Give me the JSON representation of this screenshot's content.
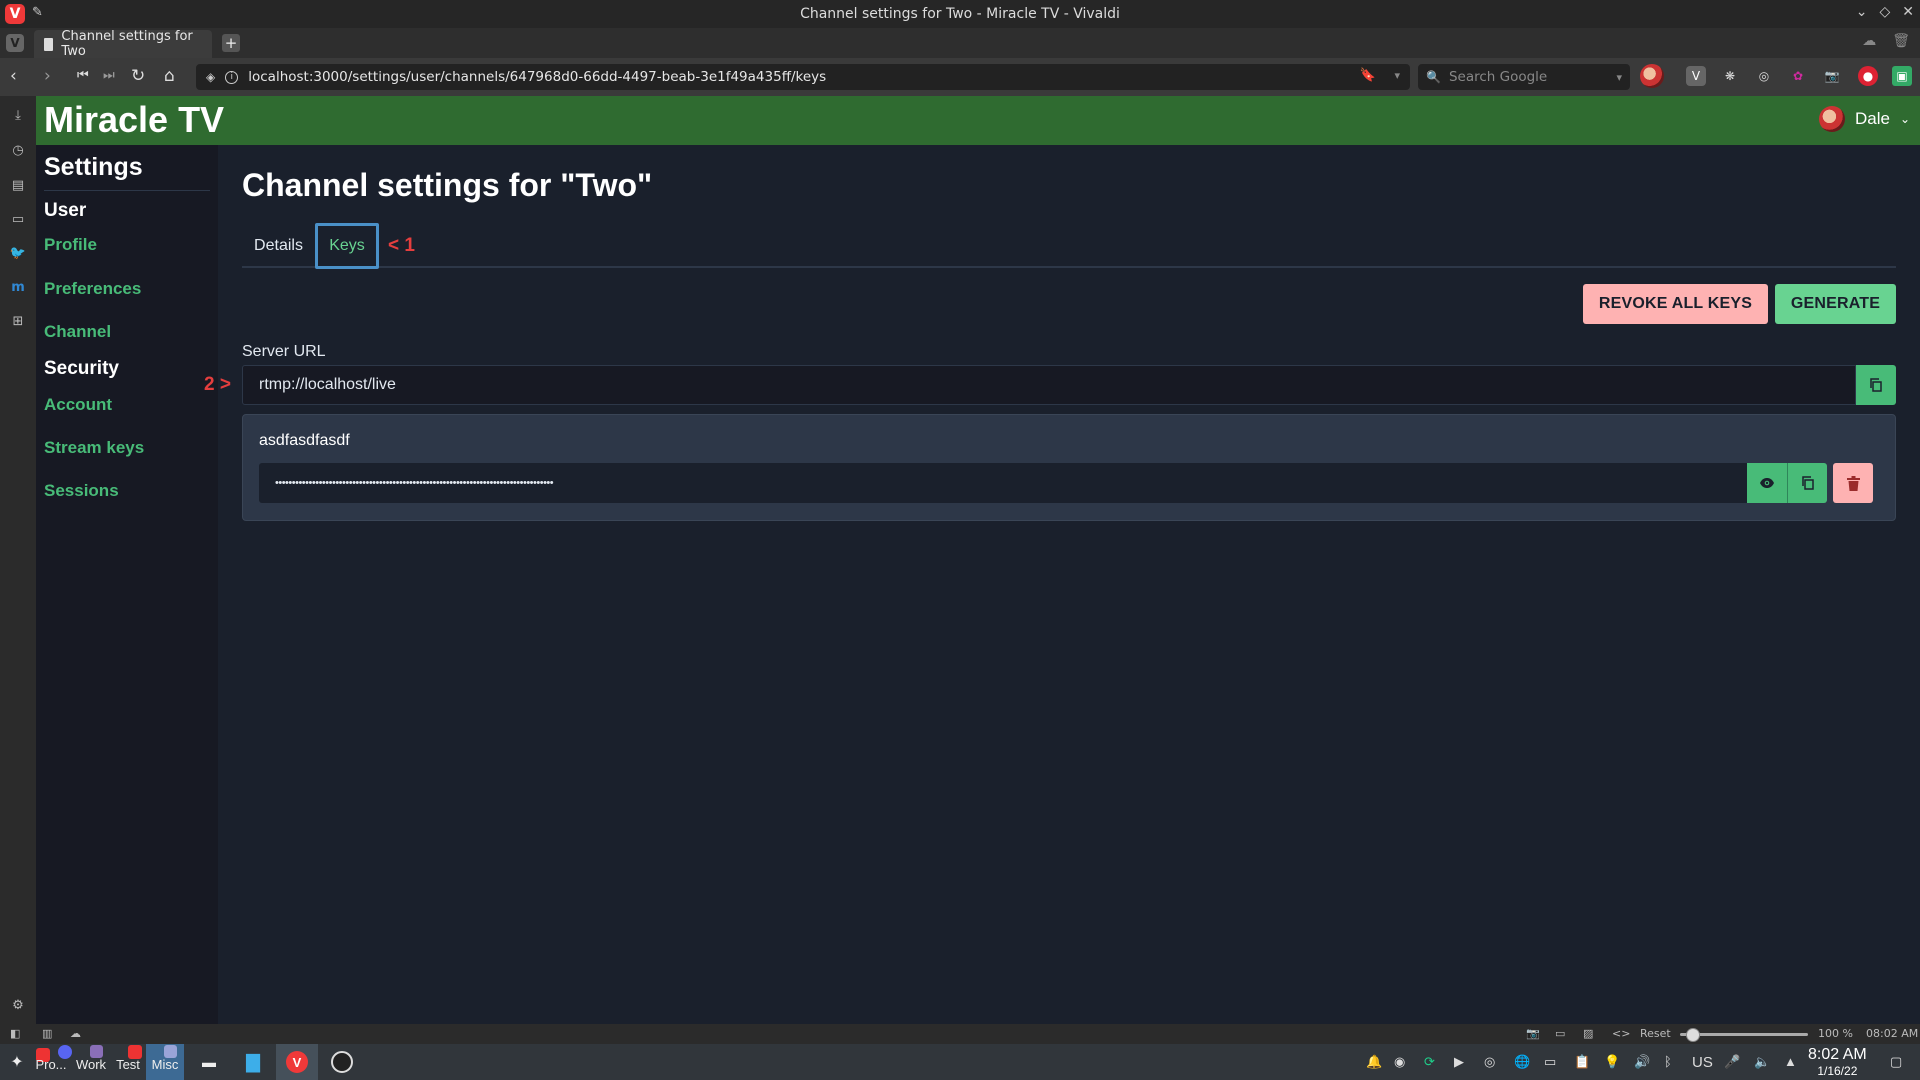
{
  "browser": {
    "window_title": "Channel settings for Two - Miracle TV - Vivaldi",
    "tab_title": "Channel settings for Two",
    "url": "localhost:3000/settings/user/channels/647968d0-66dd-4497-beab-3e1f49a435ff/keys",
    "search_placeholder": "Search Google",
    "status": {
      "reset": "Reset",
      "zoom": "100 %",
      "time": "08:02 AM",
      "zoom_level": 0.1
    }
  },
  "header": {
    "brand": "Miracle TV",
    "username": "Dale"
  },
  "sidebar": {
    "title": "Settings",
    "sections": [
      {
        "heading": "User",
        "items": [
          "Profile",
          "Preferences",
          "Channel"
        ]
      },
      {
        "heading": "Security",
        "items": [
          "Account",
          "Stream keys",
          "Sessions"
        ]
      }
    ]
  },
  "main": {
    "title": "Channel settings for \"Two\"",
    "tabs": [
      "Details",
      "Keys"
    ],
    "active_tab": "Keys",
    "annotations": {
      "tab_marker": "< 1",
      "url_marker": "2 >"
    },
    "buttons": {
      "revoke_all": "REVOKE ALL KEYS",
      "generate": "GENERATE"
    },
    "server_url_label": "Server URL",
    "server_url": "rtmp://localhost/live",
    "keys": [
      {
        "name": "asdfasdfasdf",
        "masked_value": "•••••••••••••••••••••••••••••••••••••••••••••••••••••••••••••••••••••••••••••••••••"
      }
    ]
  },
  "taskbar": {
    "tasks": [
      "Pro...",
      "Work",
      "Test",
      "Misc"
    ],
    "keyboard_layout": "US",
    "time": "8:02 AM",
    "date": "1/16/22"
  },
  "colors": {
    "header_green": "#2f6b30",
    "accent_green": "#48bb78",
    "danger_pink": "#feb2b2",
    "annotation_red": "#e53e3e",
    "focus_blue": "#4a90c8"
  }
}
